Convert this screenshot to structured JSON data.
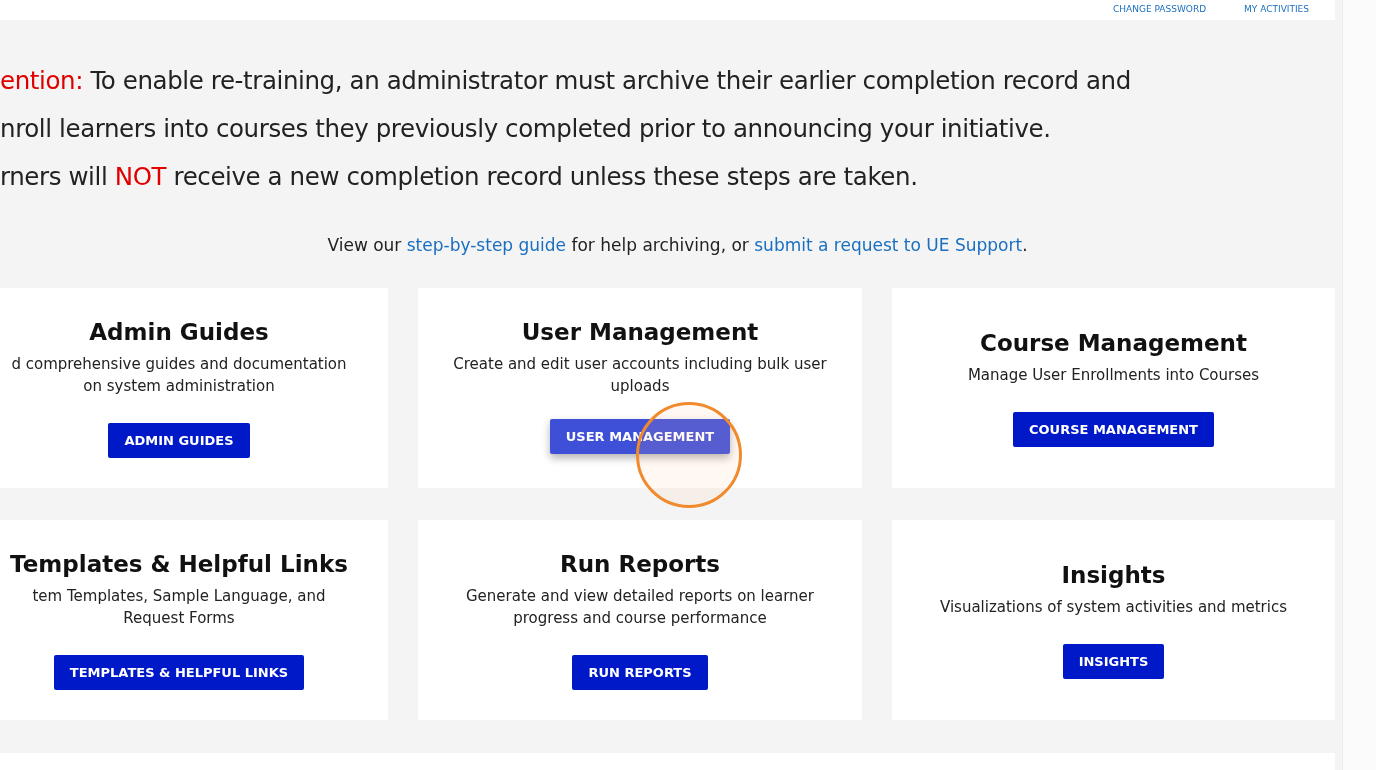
{
  "header": {
    "links": [
      "CHANGE PASSWORD",
      "MY ACTIVITIES"
    ]
  },
  "notice": {
    "lines": [
      [
        {
          "text": "ention:",
          "alert": true
        },
        {
          "text": " To enable re-training, an administrator must archive their earlier completion record and",
          "alert": false
        }
      ],
      [
        {
          "text": "nroll learners into courses they previously completed prior to announcing your initiative.",
          "alert": false
        }
      ],
      [
        {
          "text": "rners will ",
          "alert": false
        },
        {
          "text": "NOT",
          "alert": true
        },
        {
          "text": " receive a new completion record unless these steps are taken.",
          "alert": false
        }
      ]
    ]
  },
  "guide": [
    {
      "kind": "text",
      "text": "View our "
    },
    {
      "kind": "link",
      "text": "step-by-step guide"
    },
    {
      "kind": "text",
      "text": " for help archiving, or "
    },
    {
      "kind": "link",
      "text": "submit a request to UE Support"
    },
    {
      "kind": "text",
      "text": "."
    }
  ],
  "cards": [
    {
      "title": "Admin Guides",
      "description": "d comprehensive guides and documentation on system administration",
      "button": {
        "label": "ADMIN GUIDES",
        "hovered": false
      }
    },
    {
      "title": "User Management",
      "description": "Create and edit user accounts including bulk user uploads",
      "button": {
        "label": "USER MANAGEMENT",
        "hovered": true,
        "click_marker": true
      }
    },
    {
      "title": "Course Management",
      "description": "Manage User Enrollments into Courses",
      "button": {
        "label": "COURSE MANAGEMENT",
        "hovered": false
      }
    },
    {
      "title": "Templates & Helpful Links",
      "description": "tem Templates, Sample Language, and Request Forms",
      "button": {
        "label": "TEMPLATES & HELPFUL LINKS",
        "hovered": false
      }
    },
    {
      "title": "Run Reports",
      "description": "Generate and view detailed reports on learner progress and course performance",
      "button": {
        "label": "RUN REPORTS",
        "hovered": false
      }
    },
    {
      "title": "Insights",
      "description": "Visualizations of system activities and metrics",
      "button": {
        "label": "INSIGHTS",
        "hovered": false
      }
    }
  ]
}
